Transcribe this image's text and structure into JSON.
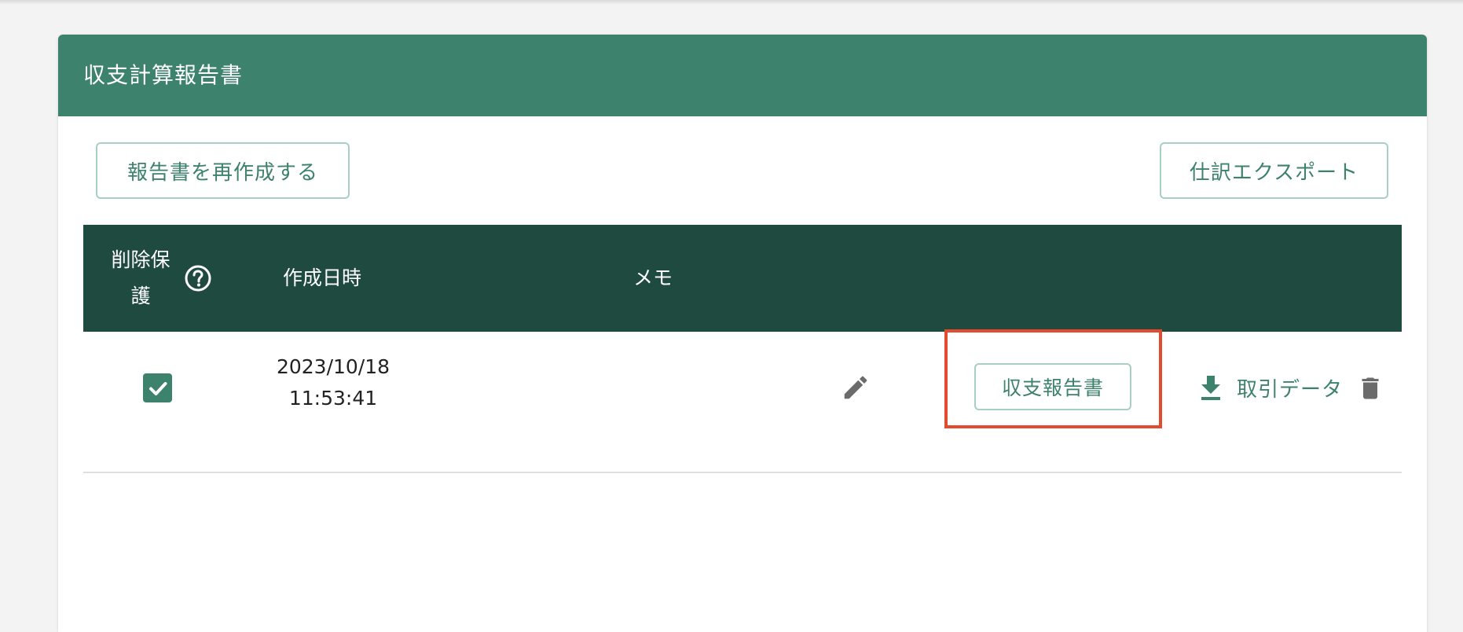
{
  "panel": {
    "title": "収支計算報告書"
  },
  "toolbar": {
    "recreate_label": "報告書を再作成する",
    "export_label": "仕訳エクスポート"
  },
  "table": {
    "headers": {
      "protect_line1": "削除保",
      "protect_line2": "護",
      "created_at": "作成日時",
      "memo": "メモ"
    },
    "rows": [
      {
        "protected": true,
        "date": "2023/10/18",
        "time": "11:53:41",
        "memo": "",
        "report_label": "収支報告書",
        "download_label": "取引データ"
      }
    ]
  },
  "icons": {
    "help": "help-circle-icon",
    "checkbox": "check-icon",
    "edit": "pencil-icon",
    "download": "download-icon",
    "delete": "trash-icon"
  },
  "colors": {
    "header_bg": "#3d826c",
    "table_head_bg": "#1f4a40",
    "accent": "#3d826c",
    "highlight": "#e34b2f",
    "icon_gray": "#6b6b6b"
  }
}
